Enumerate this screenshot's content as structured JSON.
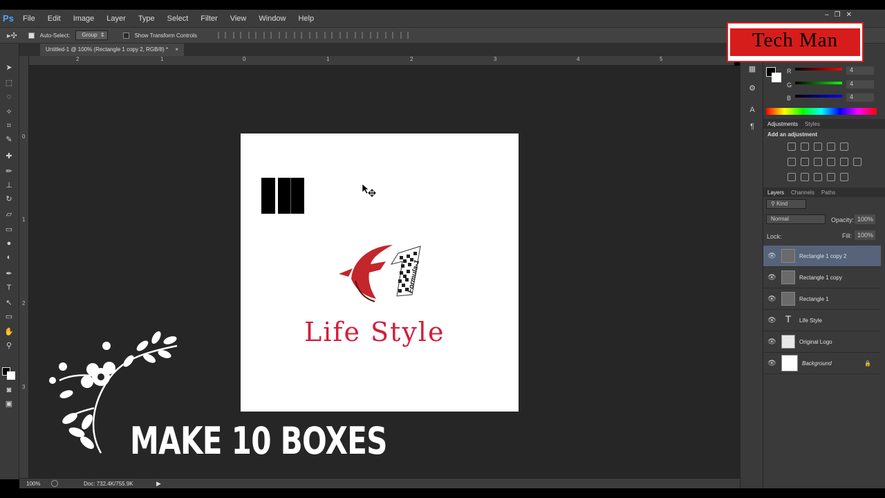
{
  "app": {
    "logo_text": "Ps"
  },
  "menu": [
    "File",
    "Edit",
    "Image",
    "Layer",
    "Type",
    "Select",
    "Filter",
    "View",
    "Window",
    "Help"
  ],
  "window_controls": [
    "–",
    "❐",
    "✕"
  ],
  "options_bar": {
    "auto_select_label": "Auto-Select:",
    "auto_select_value": "Group",
    "show_transform_label": "Show Transform Controls"
  },
  "document_tab": {
    "title": "Untitled-1 @ 100% (Rectangle 1 copy 2, RGB/8) *",
    "close": "×"
  },
  "ruler": {
    "h_labels": [
      "2",
      "1",
      "0",
      "1",
      "2",
      "3",
      "4",
      "5"
    ],
    "v_labels": [
      "0",
      "1",
      "2",
      "3"
    ]
  },
  "canvas": {
    "logo_text": "Formula-1",
    "life_style": "Life Style",
    "black_boxes": 3
  },
  "overlay": {
    "headline": "MAKE 10 BOXES"
  },
  "watermark": {
    "text": "Tech Man"
  },
  "status_bar": {
    "zoom": "100%",
    "doc": "Doc: 732.4K/755.9K"
  },
  "color_panel": {
    "r_label": "R",
    "r_value": "4",
    "g_label": "G",
    "g_value": "4",
    "b_label": "B",
    "b_value": "4"
  },
  "adjustments_panel": {
    "tabs": [
      "Adjustments",
      "Styles"
    ],
    "heading": "Add an adjustment"
  },
  "layers_panel": {
    "tabs": [
      "Layers",
      "Channels",
      "Paths"
    ],
    "kind_label": "Kind",
    "blend_mode": "Normal",
    "opacity_label": "Opacity:",
    "opacity_value": "100%",
    "lock_label": "Lock:",
    "fill_label": "Fill:",
    "fill_value": "100%",
    "layers": [
      {
        "name": "Rectangle 1 copy 2",
        "selected": true
      },
      {
        "name": "Rectangle 1 copy"
      },
      {
        "name": "Rectangle 1"
      },
      {
        "name": "Life Style"
      },
      {
        "name": "Original Logo"
      },
      {
        "name": "Background"
      }
    ]
  },
  "colors": {
    "accent_red": "#d41e3a",
    "selection_blue": "#56637a",
    "ps_blue": "#4ea6ff"
  }
}
